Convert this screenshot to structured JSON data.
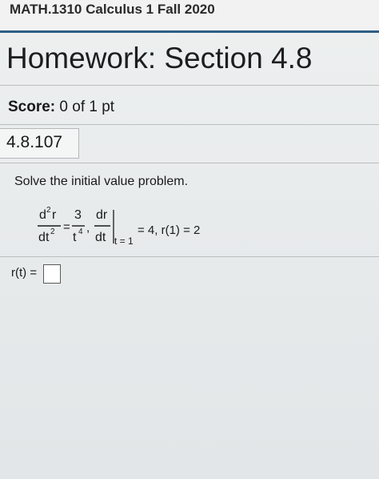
{
  "course": {
    "title": "MATH.1310 Calculus 1 Fall 2020"
  },
  "assignment": {
    "title": "Homework: Section 4.8"
  },
  "score": {
    "label": "Score:",
    "value": "0 of 1 pt"
  },
  "question": {
    "number": "4.8.107",
    "instruction": "Solve the initial value problem.",
    "equation": {
      "d": "d",
      "r": "r",
      "t": "t",
      "two": "2",
      "three": "3",
      "four": "4",
      "eq_sign": "=",
      "comma": ",",
      "dr": "dr",
      "dt": "dt",
      "eval_at": "t = 1",
      "conditions": "= 4, r(1) = 2"
    },
    "answer": {
      "label": "r(t) =",
      "value": ""
    }
  }
}
